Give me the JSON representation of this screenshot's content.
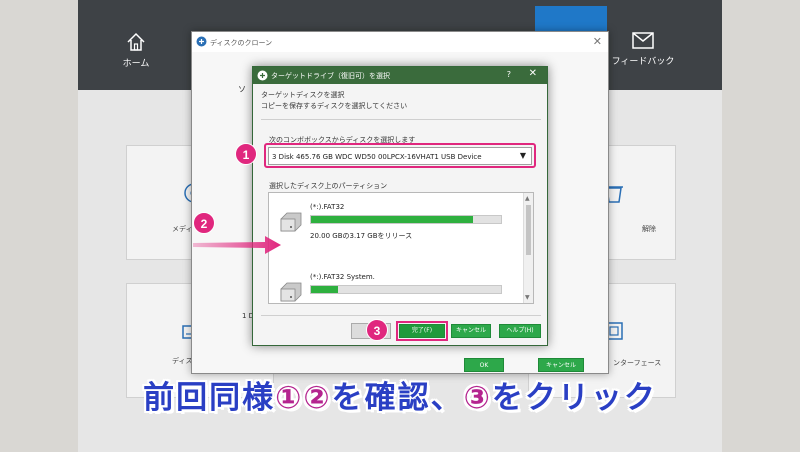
{
  "app": {
    "nav": {
      "home": "ホーム",
      "feedback": "フィードバック"
    },
    "bg_labels": {
      "card1": "メディ",
      "card2": "ディス",
      "card3": "解除",
      "card4": "ンターフェース"
    }
  },
  "clone_dialog": {
    "title": "ディスクのクローン",
    "label_so": "ソ",
    "label_1d": "1 D",
    "ok": "OK",
    "cancel": "キャンセル"
  },
  "target_dialog": {
    "title": "ターゲットドライブ（復旧可）を選択",
    "help": "?",
    "instruction1": "ターゲットディスクを選択",
    "instruction2": "コピーを保存するディスクを選択してください",
    "combo_label": "次のコンボボックスからディスクを選択します",
    "combo_value": "3 Disk 465.76 GB WDC WD50 00LPCX-16VHAT1   USB Device",
    "partition_label": "選択したディスク上のパーティション",
    "partitions": [
      {
        "name": "(*:).FAT32",
        "info": "20.00 GBの3.17 GBをリリース",
        "used": 0.85
      },
      {
        "name": "(*:).FAT32 System.",
        "info": "",
        "used": 0.14
      }
    ],
    "hidden_btn": "<",
    "finish": "完了(F)",
    "cancel": "キャンセル",
    "help_btn": "ヘルプ(H)"
  },
  "annotations": {
    "badge1": "1",
    "badge2": "2",
    "badge3": "3",
    "color": "#e0277e"
  },
  "caption": {
    "part1": "前回同様",
    "circ1": "①",
    "circ2": "②",
    "part2": "を確認、",
    "circ3": "③",
    "part3": "をクリック"
  }
}
